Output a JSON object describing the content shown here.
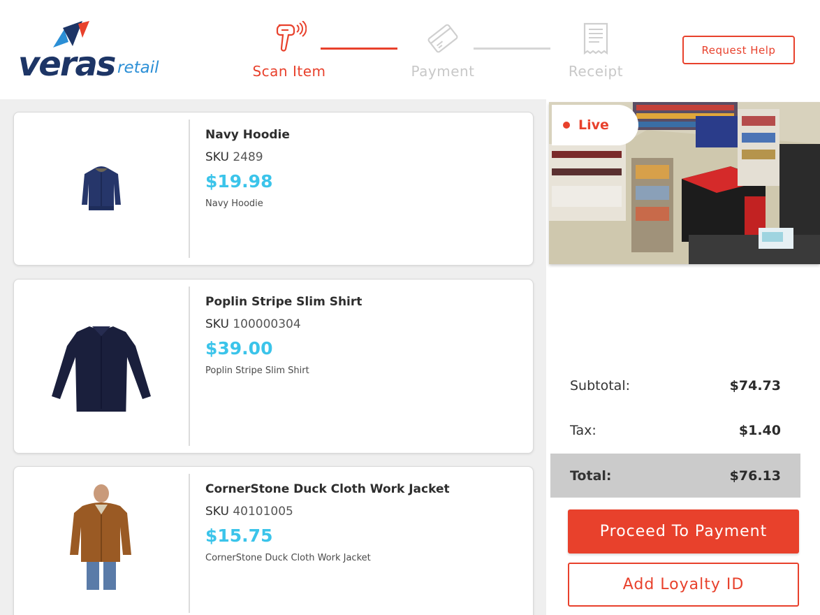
{
  "brand": {
    "name": "veras",
    "sub": "retail",
    "colors": {
      "navy": "#1d3566",
      "blue": "#2b8fd6",
      "red": "#e8412c"
    }
  },
  "steps": [
    {
      "label": "Scan Item",
      "icon": "barcode-scanner-icon",
      "state": "active"
    },
    {
      "label": "Payment",
      "icon": "credit-card-icon",
      "state": "inactive"
    },
    {
      "label": "Receipt",
      "icon": "receipt-icon",
      "state": "inactive"
    }
  ],
  "header": {
    "help_label": "Request Help"
  },
  "items": [
    {
      "name": "Navy Hoodie",
      "sku_label": "SKU",
      "sku": "2489",
      "price": "$19.98",
      "desc": "Navy Hoodie",
      "image": "hoodie-image"
    },
    {
      "name": "Poplin Stripe Slim Shirt",
      "sku_label": "SKU",
      "sku": "100000304",
      "price": "$39.00",
      "desc": "Poplin Stripe Slim Shirt",
      "image": "shirt-image"
    },
    {
      "name": "CornerStone Duck Cloth Work Jacket",
      "sku_label": "SKU",
      "sku": "40101005",
      "price": "$15.75",
      "desc": "CornerStone Duck Cloth Work Jacket",
      "image": "jacket-image"
    }
  ],
  "camera": {
    "live_label": "Live"
  },
  "summary": {
    "subtotal_label": "Subtotal:",
    "subtotal": "$74.73",
    "tax_label": "Tax:",
    "tax": "$1.40",
    "total_label": "Total:",
    "total": "$76.13"
  },
  "actions": {
    "pay_label": "Proceed To Payment",
    "loyalty_label": "Add Loyalty ID"
  },
  "colors": {
    "accent": "#e8412c",
    "price": "#3bc4ea",
    "panel_bg": "#efefef"
  }
}
